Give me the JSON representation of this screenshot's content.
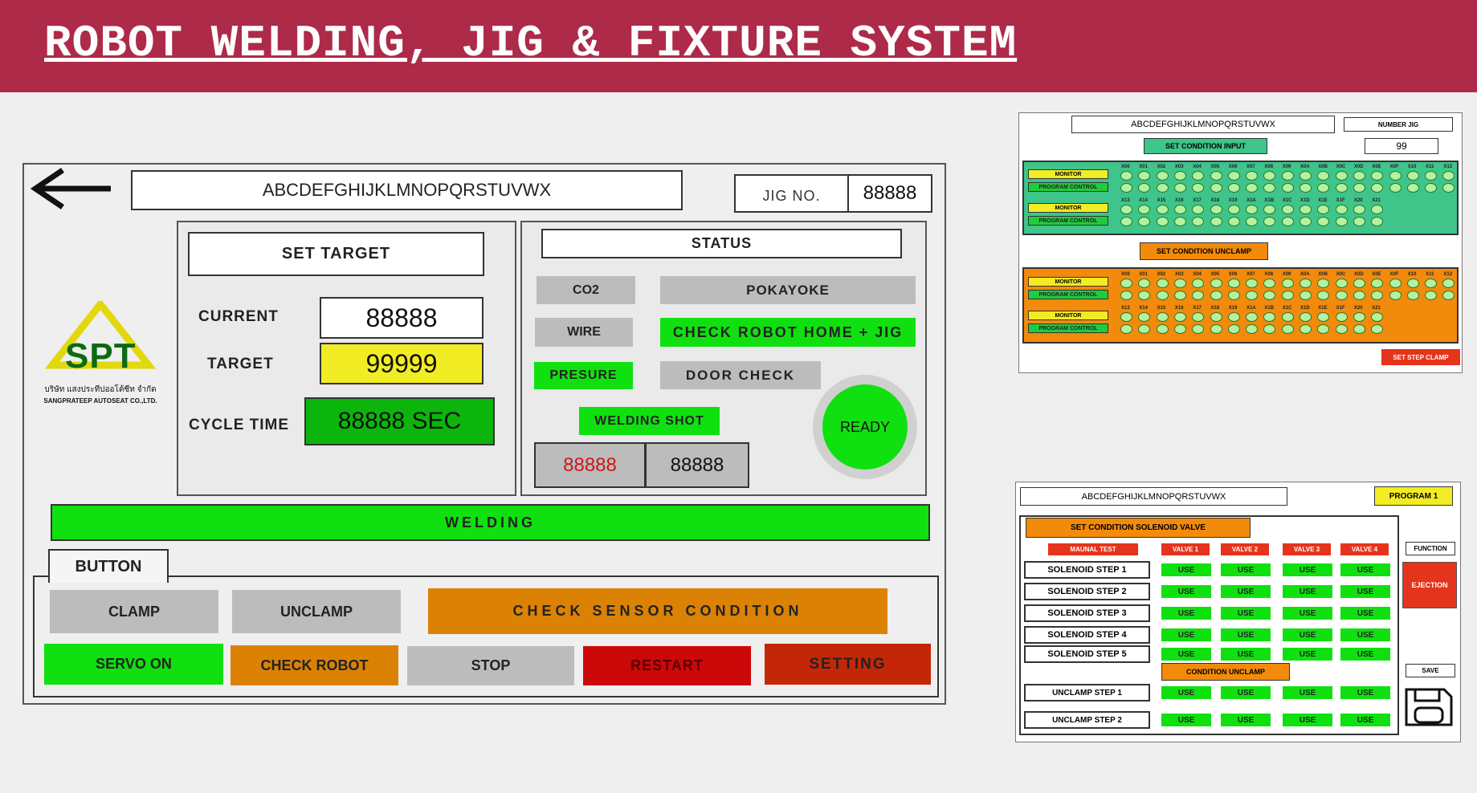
{
  "header": {
    "title": "ROBOT WELDING, JIG & FIXTURE SYSTEM"
  },
  "main": {
    "name_field": "ABCDEFGHIJKLMNOPQRSTUVWX",
    "jig_label": "JIG NO.",
    "jig_value": "88888",
    "logo": {
      "text": "SPT",
      "thai": "บริษัท แสงประทีปออโต้ซีท จำกัด",
      "company": "SANGPRATEEP AUTOSEAT CO.,LTD."
    },
    "target_panel": {
      "title": "SET TARGET",
      "current_label": "CURRENT",
      "current_value": "88888",
      "target_label": "TARGET",
      "target_value": "99999",
      "cycle_label": "CYCLE TIME",
      "cycle_value": "88888 SEC"
    },
    "status_panel": {
      "title": "STATUS",
      "co2": "CO2",
      "pokayoke": "POKAYOKE",
      "wire": "WIRE",
      "check_home": "CHECK ROBOT HOME + JIG",
      "presure": "PRESURE",
      "door_check": "DOOR CHECK",
      "welding_shot": "WELDING SHOT",
      "shot_a": "88888",
      "shot_b": "88888",
      "ready": "READY"
    },
    "welding_bar": "WELDING",
    "button_tab": "BUTTON",
    "buttons": {
      "clamp": "CLAMP",
      "unclamp": "UNCLAMP",
      "check_sensor": "CHECK SENSOR CONDITION",
      "servo_on": "SERVO ON",
      "check_robot": "CHECK ROBOT",
      "stop": "STOP",
      "restart": "RESTART",
      "setting": "SETTING"
    }
  },
  "io_panel": {
    "name_field": "ABCDEFGHIJKLMNOPQRSTUVWX",
    "number_jig_label": "NUMBER JIG",
    "number_jig_value": "99",
    "set_input": "SET CONDITION INPUT",
    "set_unclamp": "SET CONDITION UNCLAMP",
    "monitor": "MONITOR",
    "program_control": "PROGRAM CONTROL",
    "row1_labels": [
      "X00",
      "X01",
      "X02",
      "X03",
      "X04",
      "X05",
      "X06",
      "X07",
      "X08",
      "X09",
      "X0A",
      "X0B",
      "X0C",
      "X0D",
      "X0E",
      "X0F",
      "X10",
      "X11",
      "X12"
    ],
    "row2_labels": [
      "X13",
      "X14",
      "X15",
      "X16",
      "X17",
      "X18",
      "X19",
      "X1A",
      "X1B",
      "X1C",
      "X1D",
      "X1E",
      "X1F",
      "X20",
      "X21"
    ],
    "set_step_clamp": "SET STEP CLAMP",
    "colors": {
      "input_bg": "#3fc48a",
      "unclamp_bg": "#f28a0b"
    }
  },
  "valve_panel": {
    "name_field": "ABCDEFGHIJKLMNOPQRSTUVWX",
    "program": "PROGRAM 1",
    "set_solenoid": "SET CONDITION SOLENOID VALVE",
    "manual_test": "MAUNAL TEST",
    "valves": [
      "VALVE 1",
      "VALVE 2",
      "VALVE 3",
      "VALVE 4"
    ],
    "steps": [
      "SOLENOID STEP 1",
      "SOLENOID STEP 2",
      "SOLENOID STEP 3",
      "SOLENOID STEP 4",
      "SOLENOID STEP 5"
    ],
    "condition_unclamp": "CONDITION UNCLAMP",
    "unclamp_steps": [
      "UNCLAMP STEP 1",
      "UNCLAMP STEP 2"
    ],
    "use_label": "USE",
    "function": "FUNCTION",
    "ejection": "EJECTION",
    "save": "SAVE"
  }
}
